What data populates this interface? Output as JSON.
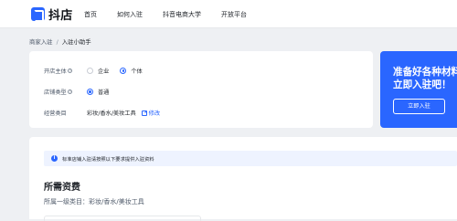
{
  "header": {
    "logo_text": "抖店",
    "nav": [
      "首页",
      "如何入驻",
      "抖音电商大学",
      "开放平台"
    ]
  },
  "breadcrumb": {
    "parent": "商家入驻",
    "separator": "/",
    "current": "入驻小助手"
  },
  "form": {
    "subject": {
      "label": "开店主体",
      "options": [
        {
          "label": "企业",
          "checked": false
        },
        {
          "label": "个体",
          "checked": true
        }
      ]
    },
    "store_type": {
      "label": "店铺类型",
      "options": [
        {
          "label": "普通",
          "checked": true
        }
      ]
    },
    "category": {
      "label": "经营类目",
      "value": "彩妆/香水/美妆工具",
      "edit_label": "修改"
    },
    "help_mark": "?"
  },
  "promo": {
    "title_line1": "准备好各种材料",
    "title_line2": "立即入驻吧！",
    "button_label": "立即入驻"
  },
  "content": {
    "notice_icon": "i",
    "notice_text": "标准店铺入驻请按照以下要求提供入驻资料",
    "section_title": "所需资费",
    "category_line": "所属一级类目：彩妆/香水/美妆工具"
  },
  "colors": {
    "accent": "#2a66ff",
    "page_bg": "#eef0f3",
    "card_bg": "#ffffff"
  },
  "icons": {
    "logo": "logo-icon",
    "help": "question-circle-icon",
    "edit": "edit-icon",
    "info": "info-circle-icon"
  }
}
